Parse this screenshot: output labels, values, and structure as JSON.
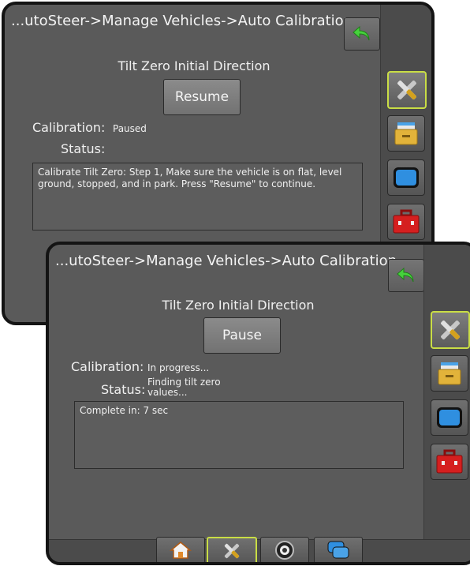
{
  "screen_back": {
    "title": "...utoSteer->Manage Vehicles->Auto Calibration",
    "heading": "Tilt Zero Initial Direction",
    "action_label": "Resume",
    "calibration_label": "Calibration:",
    "calibration_value": "Paused",
    "status_label": "Status:",
    "message": "Calibrate Tilt Zero: Step 1, Make sure the vehicle is on flat, level ground, stopped, and in park. Press \"Resume\" to continue."
  },
  "screen_front": {
    "title": "...utoSteer->Manage Vehicles->Auto Calibration",
    "heading": "Tilt Zero Initial Direction",
    "action_label": "Pause",
    "calibration_label": "Calibration:",
    "calibration_value": "In progress...",
    "status_label": "Status:",
    "status_value": "Finding tilt zero values...",
    "message": "Complete in: 7 sec"
  },
  "sidebar_icons": [
    "tools-icon",
    "file-drawer-icon",
    "screen-icon",
    "toolbox-icon"
  ],
  "bottom_nav_icons": [
    "home-icon",
    "tools-icon",
    "gauge-icon",
    "display-icon"
  ],
  "colors": {
    "active_border": "#c9dd45",
    "screen_bg": "#5a5a5a",
    "bezel": "#141414"
  }
}
